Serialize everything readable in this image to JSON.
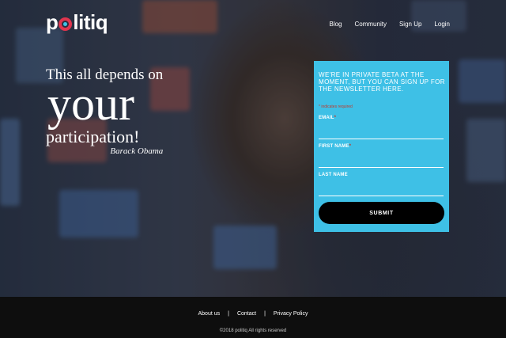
{
  "brand": {
    "logo_pre": "p",
    "logo_post": "litiq"
  },
  "nav": {
    "items": [
      {
        "label": "Blog"
      },
      {
        "label": "Community"
      },
      {
        "label": "Sign Up"
      },
      {
        "label": "Login"
      }
    ]
  },
  "hero": {
    "quote_line1": "This all depends on",
    "quote_line2": "your",
    "quote_line3": "participation!",
    "attribution": "Barack Obama"
  },
  "signup_form": {
    "heading": "WE'RE IN PRIVATE BETA AT THE MOMENT, BUT YOU CAN SIGN UP FOR THE NEWSLETTER HERE.",
    "required_note": "* indicates required",
    "email_label": "EMAIL",
    "first_name_label": "FIRST NAME",
    "last_name_label": "LAST NAME",
    "required_mark": "*",
    "submit_label": "SUBMIT",
    "email_value": "",
    "first_name_value": "",
    "last_name_value": ""
  },
  "footer": {
    "links": [
      {
        "label": "About us"
      },
      {
        "label": "Contact"
      },
      {
        "label": "Privacy Policy"
      }
    ],
    "separator": "|",
    "copyright": "©2018 politiq All rights reserved"
  },
  "colors": {
    "accent": "#3ec0e6",
    "brand_red": "#e0354e",
    "footer_bg": "#0e0e0e"
  }
}
